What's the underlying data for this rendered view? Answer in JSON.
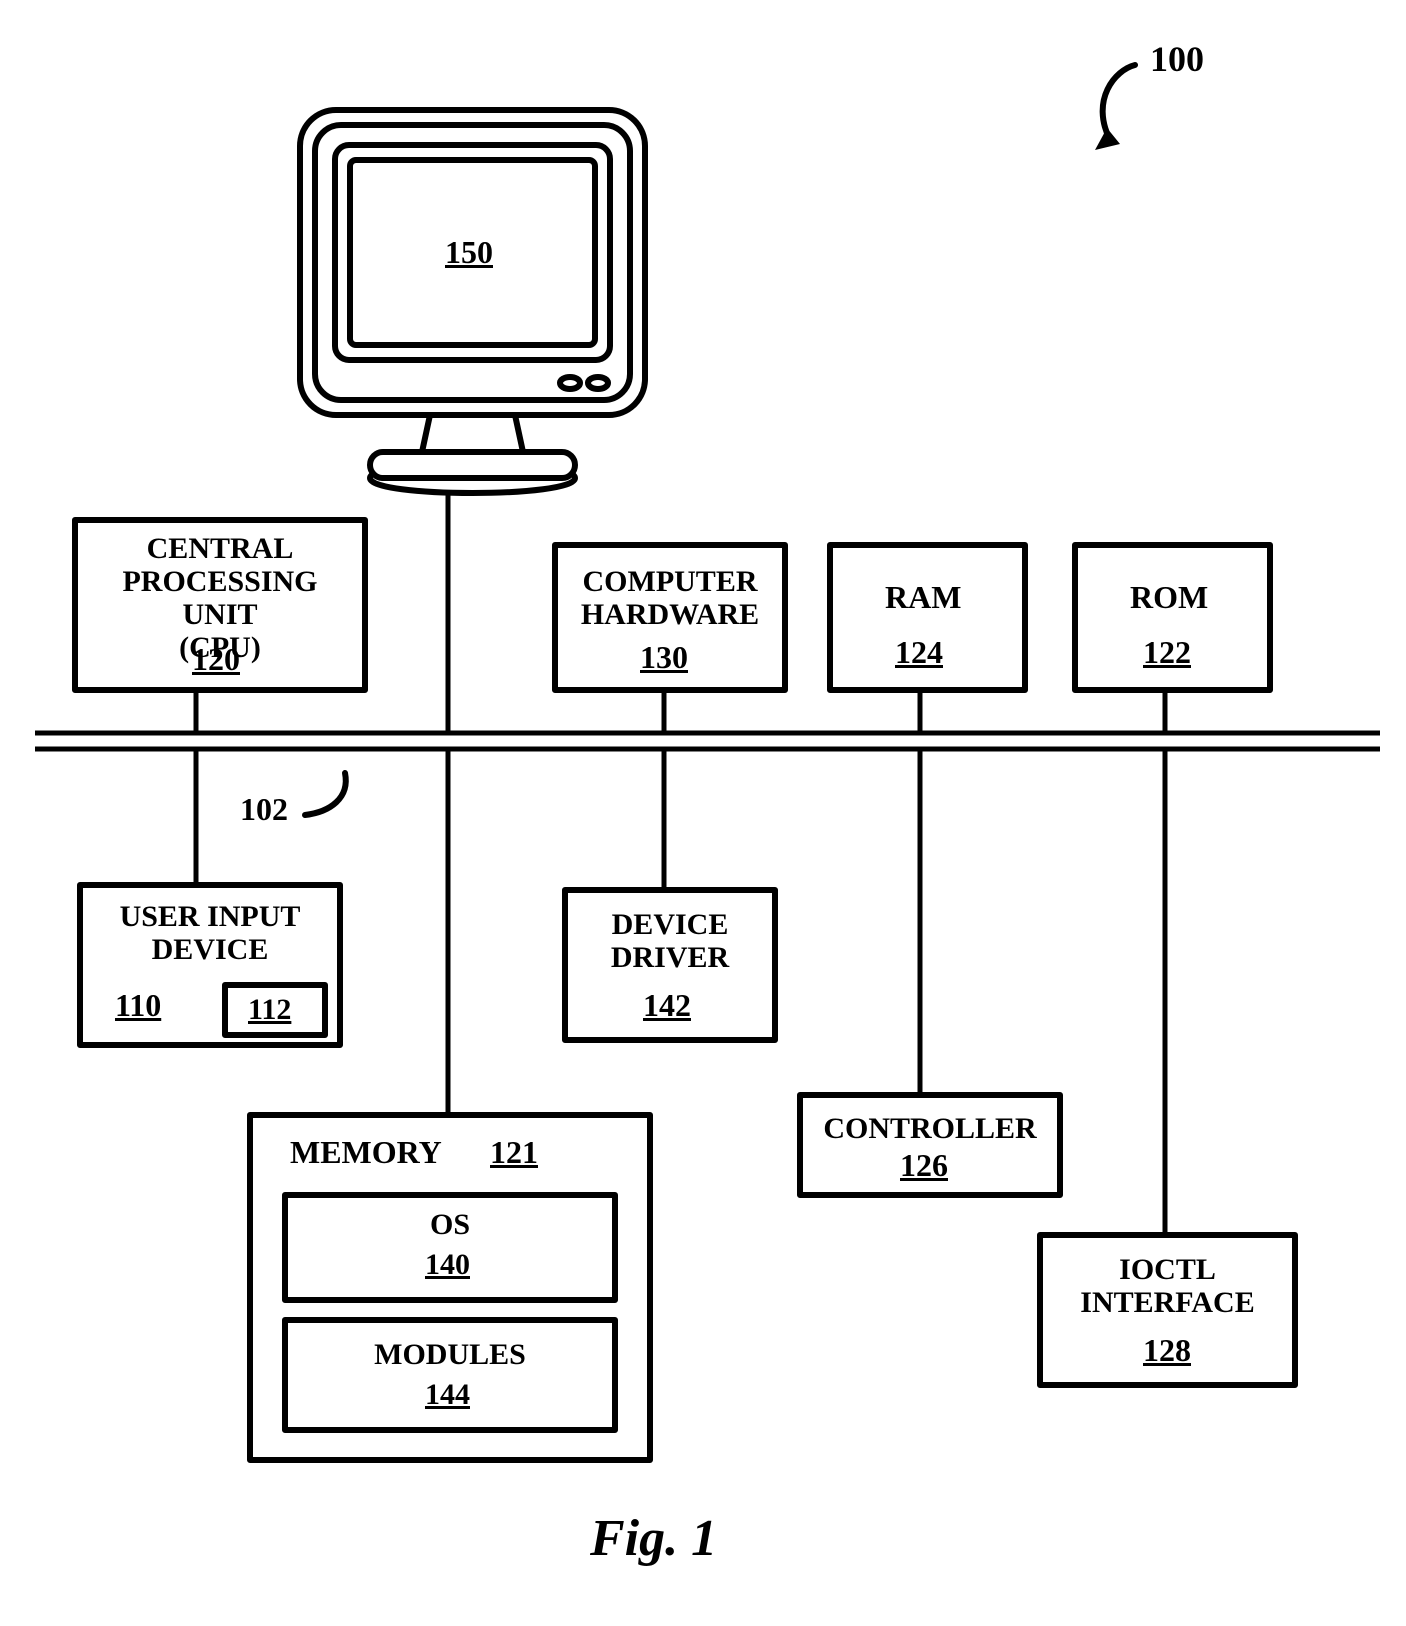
{
  "figure_number_label": "100",
  "bus_label": "102",
  "monitor": {
    "id": "150"
  },
  "cpu": {
    "title": "CENTRAL\nPROCESSING UNIT\n(CPU)",
    "id": "120"
  },
  "hw": {
    "title": "COMPUTER\nHARDWARE",
    "id": "130"
  },
  "ram": {
    "title": "RAM",
    "id": "124"
  },
  "rom": {
    "title": "ROM",
    "id": "122"
  },
  "uid": {
    "title": "USER INPUT\nDEVICE",
    "id": "110",
    "sub_id": "112"
  },
  "driver": {
    "title": "DEVICE\nDRIVER",
    "id": "142"
  },
  "controller": {
    "title": "CONTROLLER",
    "id": "126"
  },
  "ioctl": {
    "title": "IOCTL\nINTERFACE",
    "id": "128"
  },
  "memory": {
    "title": "MEMORY",
    "id": "121",
    "os_title": "OS",
    "os_id": "140",
    "mod_title": "MODULES",
    "mod_id": "144"
  },
  "caption": "Fig. 1"
}
